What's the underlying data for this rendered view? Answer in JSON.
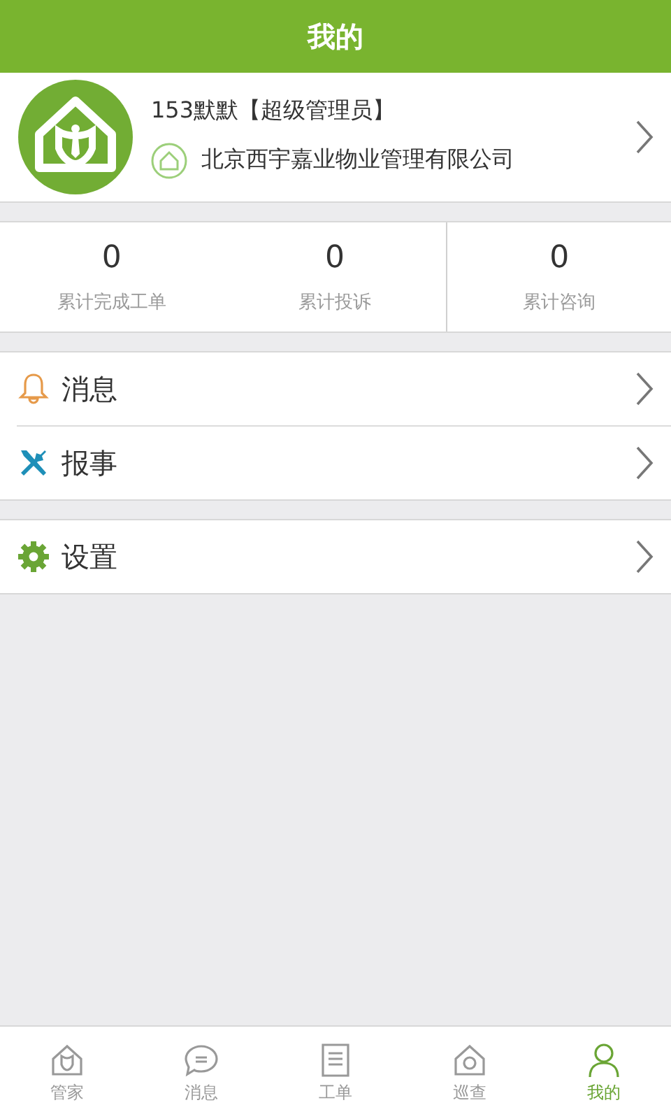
{
  "header": {
    "title": "我的"
  },
  "profile": {
    "name": "153默默【超级管理员】",
    "company": "北京西宇嘉业物业管理有限公司"
  },
  "stats": [
    {
      "value": "0",
      "label": "累计完成工单"
    },
    {
      "value": "0",
      "label": "累计投诉"
    },
    {
      "value": "0",
      "label": "累计咨询"
    }
  ],
  "menu_groups": [
    [
      {
        "kind": "bell",
        "label": "消息"
      },
      {
        "kind": "tools",
        "label": "报事"
      }
    ],
    [
      {
        "kind": "gear",
        "label": "设置"
      }
    ]
  ],
  "tab_bar": [
    {
      "kind": "house",
      "label": "管家",
      "selected": false
    },
    {
      "kind": "chat",
      "label": "消息",
      "selected": false
    },
    {
      "kind": "doc",
      "label": "工单",
      "selected": false
    },
    {
      "kind": "patrol",
      "label": "巡查",
      "selected": false
    },
    {
      "kind": "person",
      "label": "我的",
      "selected": true
    }
  ]
}
